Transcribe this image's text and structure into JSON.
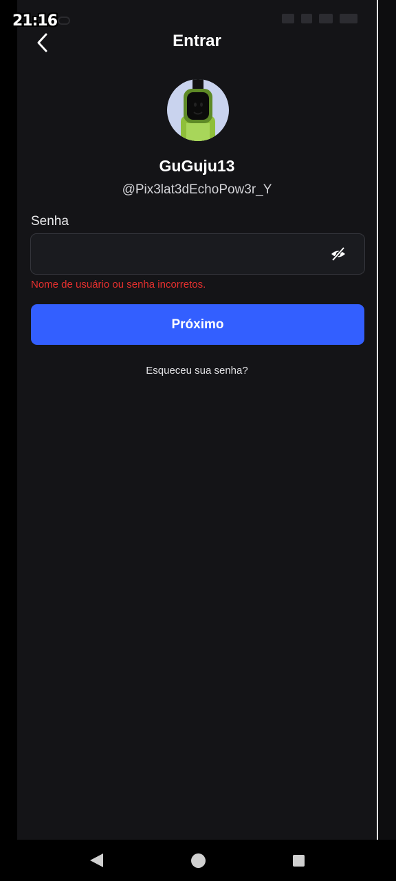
{
  "status_bar": {
    "time": "21:16"
  },
  "header": {
    "title": "Entrar",
    "back_icon": "chevron-left-icon"
  },
  "profile": {
    "display_name": "GuGuju13",
    "username": "@Pix3lat3dEchoPow3r_Y",
    "avatar_background": "#c9d3ee"
  },
  "login_form": {
    "password_label": "Senha",
    "password_value": "",
    "visibility_icon": "eye-off-icon",
    "error_message": "Nome de usuário ou senha incorretos.",
    "error_color": "#e5302e",
    "submit_label": "Próximo",
    "submit_color": "#335fff",
    "forgot_password": "Esqueceu sua senha?"
  },
  "navigation_bar": {
    "back_icon": "triangle-back-icon",
    "home_icon": "circle-home-icon",
    "recents_icon": "square-recents-icon"
  }
}
